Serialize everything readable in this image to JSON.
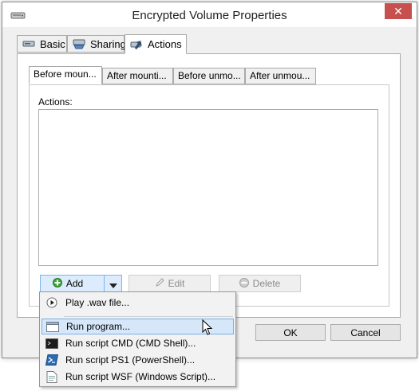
{
  "window": {
    "title": "Encrypted Volume Properties",
    "close_symbol": "✕"
  },
  "tabs": [
    {
      "label": "Basic",
      "icon": "drive-icon"
    },
    {
      "label": "Sharing",
      "icon": "sharing-drive-icon"
    },
    {
      "label": "Actions",
      "icon": "actions-icon",
      "active": true
    }
  ],
  "inner_tabs": [
    {
      "label": "Before moun...",
      "active": true
    },
    {
      "label": "After mounti..."
    },
    {
      "label": "Before unmo..."
    },
    {
      "label": "After unmou..."
    }
  ],
  "actions": {
    "label": "Actions:",
    "items": []
  },
  "buttons": {
    "add": "Add",
    "edit": "Edit",
    "delete": "Delete",
    "ok": "OK",
    "cancel": "Cancel"
  },
  "add_menu": {
    "items": [
      {
        "label": "Play .wav file...",
        "icon": "play-icon"
      },
      {
        "label": "Run program...",
        "icon": "window-icon",
        "hover": true
      },
      {
        "label": "Run script CMD (CMD Shell)...",
        "icon": "cmd-icon"
      },
      {
        "label": "Run script PS1 (PowerShell)...",
        "icon": "powershell-icon"
      },
      {
        "label": "Run script WSF (Windows Script)...",
        "icon": "script-file-icon"
      }
    ]
  },
  "colors": {
    "accent": "#7ab0e6",
    "close": "#c7504f",
    "add_green": "#3aa53a"
  }
}
